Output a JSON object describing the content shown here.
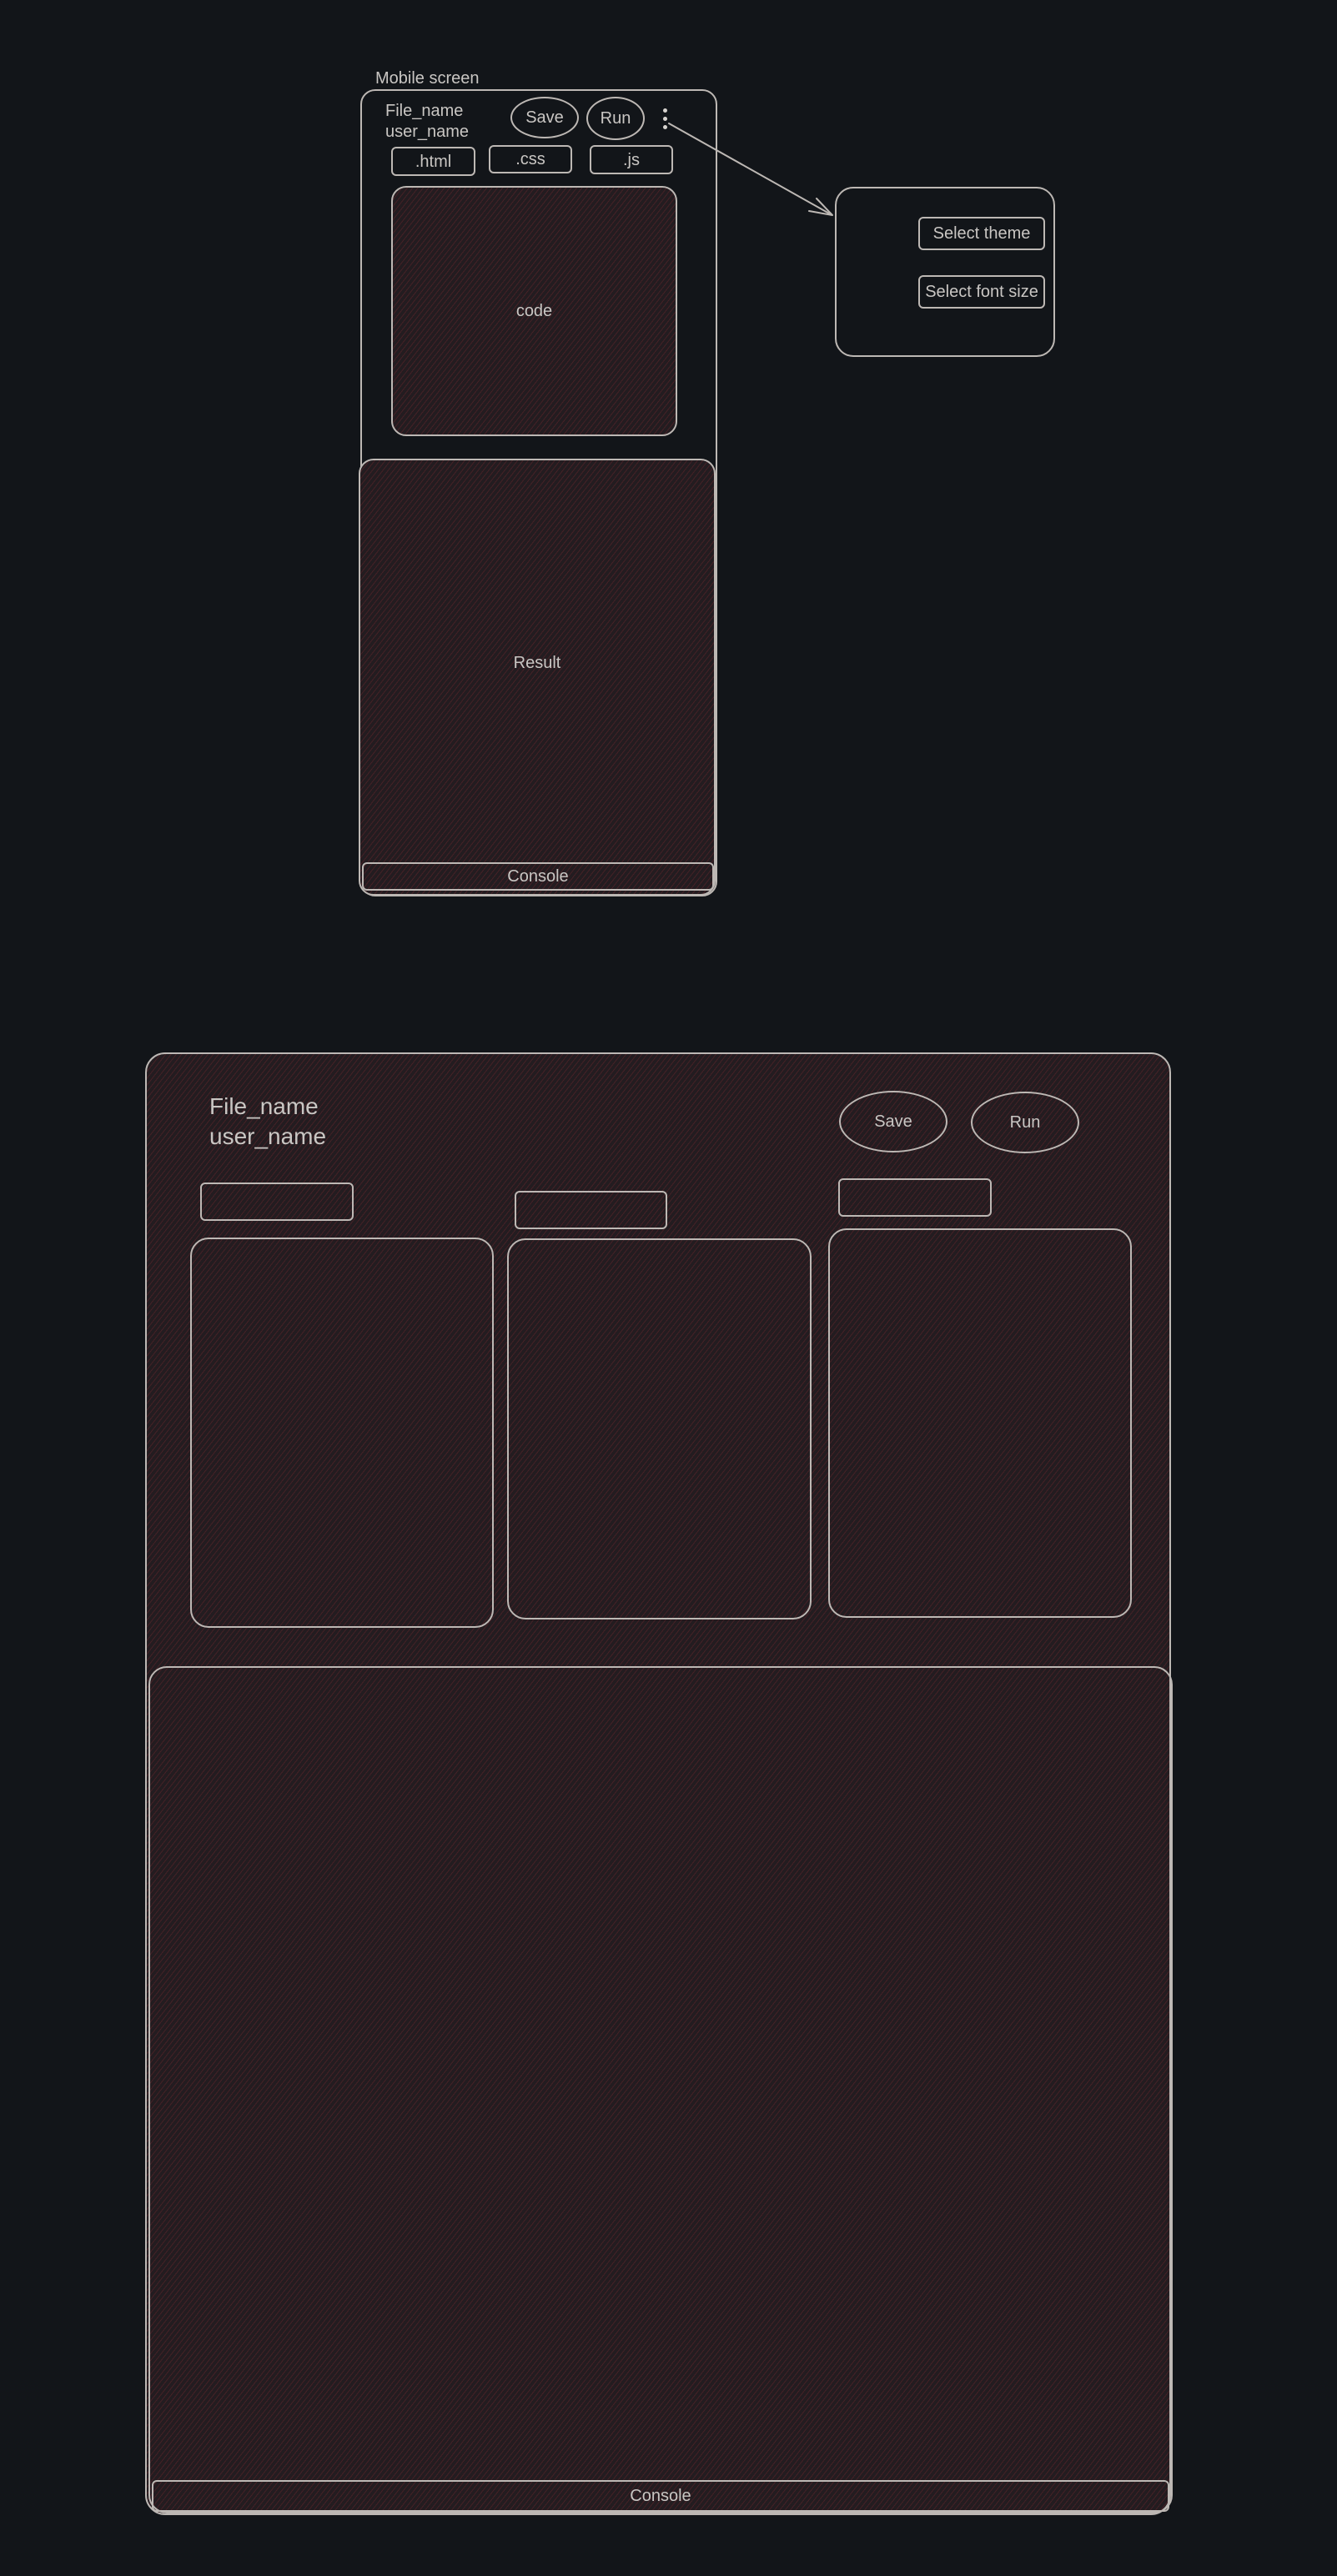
{
  "mobile": {
    "caption": "Mobile screen",
    "file_name": "File_name",
    "user_name": "user_name",
    "save_label": "Save",
    "run_label": "Run",
    "menu_icon": "vertical-ellipsis-icon",
    "tabs": [
      ".html",
      ".css",
      ".js"
    ],
    "code_label": "code",
    "result_label": "Result",
    "console_label": "Console",
    "menu": {
      "theme_label": "Select theme",
      "font_size_label": "Select font size"
    }
  },
  "desktop": {
    "file_name": "File_name",
    "user_name": "user_name",
    "save_label": "Save",
    "run_label": "Run",
    "console_label": "Console"
  },
  "colors": {
    "background": "#121519",
    "stroke": "#bdb8b4",
    "fill": "#231c20",
    "hatch": "#6e282d"
  }
}
